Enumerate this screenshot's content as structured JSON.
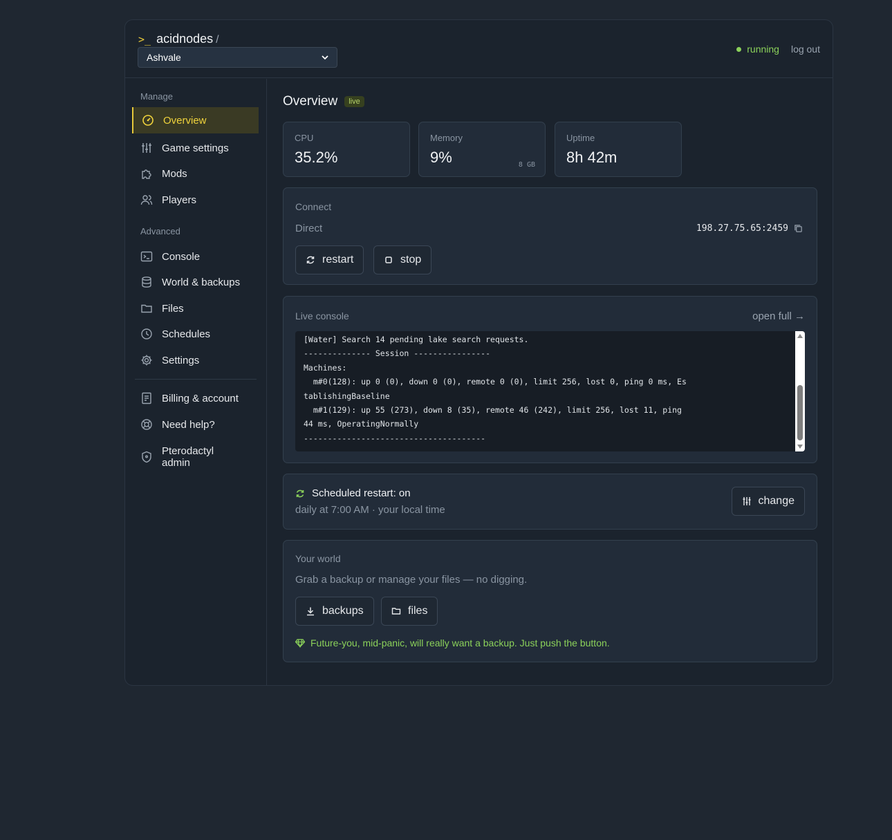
{
  "header": {
    "prompt": ">_",
    "brand": "acidnodes",
    "separator": "/",
    "server_selected": "Ashvale",
    "status": "running",
    "logout": "log out"
  },
  "sidebar": {
    "section_manage": "Manage",
    "section_advanced": "Advanced",
    "items": [
      {
        "label": "Overview",
        "icon": "gauge-icon",
        "active": true
      },
      {
        "label": "Game settings",
        "icon": "sliders-icon"
      },
      {
        "label": "Mods",
        "icon": "puzzle-icon"
      },
      {
        "label": "Players",
        "icon": "users-icon"
      },
      {
        "label": "Console",
        "icon": "terminal-icon"
      },
      {
        "label": "World & backups",
        "icon": "database-icon"
      },
      {
        "label": "Files",
        "icon": "folder-icon"
      },
      {
        "label": "Schedules",
        "icon": "clock-icon"
      },
      {
        "label": "Settings",
        "icon": "gear-icon"
      },
      {
        "label": "Billing & account",
        "icon": "receipt-icon"
      },
      {
        "label": "Need help?",
        "icon": "lifebuoy-icon"
      },
      {
        "label": "Pterodactyl admin",
        "icon": "shield-icon"
      }
    ]
  },
  "overview": {
    "title": "Overview",
    "badge": "live",
    "stats": [
      {
        "label": "CPU",
        "value": "35.2%"
      },
      {
        "label": "Memory",
        "value": "9%",
        "sub": "8 GB"
      },
      {
        "label": "Uptime",
        "value": "8h 42m"
      }
    ]
  },
  "connect": {
    "header": "Connect",
    "direct_label": "Direct",
    "address": "198.27.75.65:2459",
    "restart": "restart",
    "stop": "stop"
  },
  "live_console": {
    "header": "Live console",
    "open_full": "open full →",
    "text": "[Water] Search 14 pending lake search requests.\n-------------- Session ----------------\nMachines:\n  m#0(128): up 0 (0), down 0 (0), remote 0 (0), limit 256, lost 0, ping 0 ms, Es\ntablishingBaseline\n  m#1(129): up 55 (273), down 8 (35), remote 46 (242), limit 256, lost 11, ping\n44 ms, OperatingNormally\n--------------------------------------"
  },
  "schedule": {
    "title": "Scheduled restart: on",
    "detail": "daily at 7:00 AM · your local time",
    "change": "change"
  },
  "world": {
    "header": "Your world",
    "description": "Grab a backup or manage your files — no digging.",
    "backups": "backups",
    "files": "files",
    "tip": "Future-you, mid-panic, will really want a backup. Just push the button."
  },
  "colors": {
    "accent": "#e7c93a",
    "running": "#8bd15a",
    "background": "#1f2731",
    "panel": "#222c39"
  }
}
